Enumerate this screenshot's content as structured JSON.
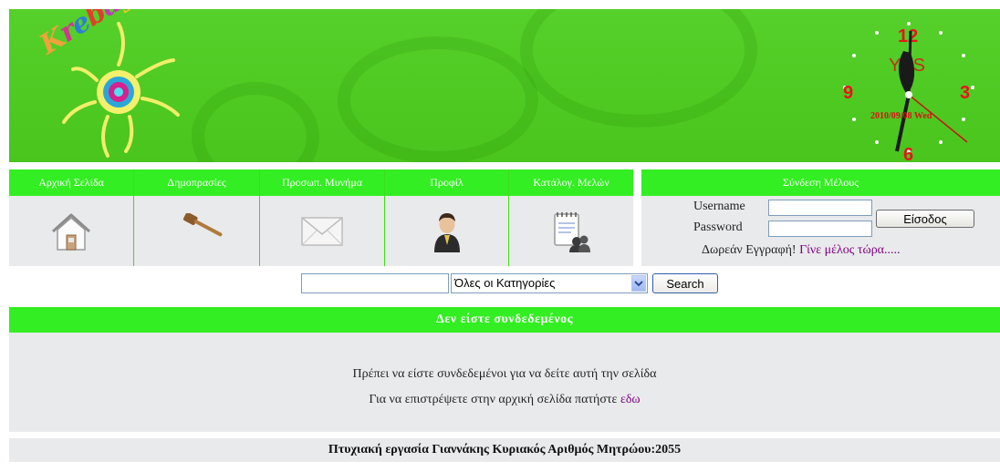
{
  "logo": {
    "text": "Krеbay"
  },
  "clock": {
    "numbers": [
      "12",
      "3",
      "6",
      "9"
    ],
    "date": "2010/09/08 Wed",
    "overlay": "YES"
  },
  "nav": {
    "items": [
      {
        "label": "Αρχική Σελίδα",
        "icon": "house-icon"
      },
      {
        "label": "Δημοπρασίες",
        "icon": "gavel-icon"
      },
      {
        "label": "Προσωπ. Μυνήμα",
        "icon": "envelope-icon"
      },
      {
        "label": "Προφίλ",
        "icon": "user-icon"
      },
      {
        "label": "Κατάλογ. Μελών",
        "icon": "notepad-icon"
      }
    ]
  },
  "login": {
    "title": "Σύνδεση Μέλους",
    "username_label": "Username",
    "password_label": "Password",
    "username_value": "",
    "password_value": "",
    "submit_label": "Είσοδος",
    "register_text": "Δωρεάν Εγγραφή!",
    "register_link": "Γίνε μέλος τώρα....."
  },
  "search": {
    "query": "",
    "category_selected": "Όλες οι Κατηγορίες",
    "button_label": "Search"
  },
  "content": {
    "status_title": "Δεν είστε συνδεδεμένος",
    "line1": "Πρέπει να είστε συνδεδεμένοι για να δείτε αυτή την σελίδα",
    "line2_prefix": "Για να επιστρέψετε στην αρχική σελίδα πατήστε",
    "line2_link": "εδω"
  },
  "footer": {
    "text": "Πτυχιακή εργασία Γιαννάκης Κυριακός Αριθμός Μητρώου:2055"
  },
  "colors": {
    "banner_green": "#4fca22",
    "nav_green": "#33ee22",
    "panel_gray": "#e9eaec",
    "link_purple": "#800080"
  }
}
